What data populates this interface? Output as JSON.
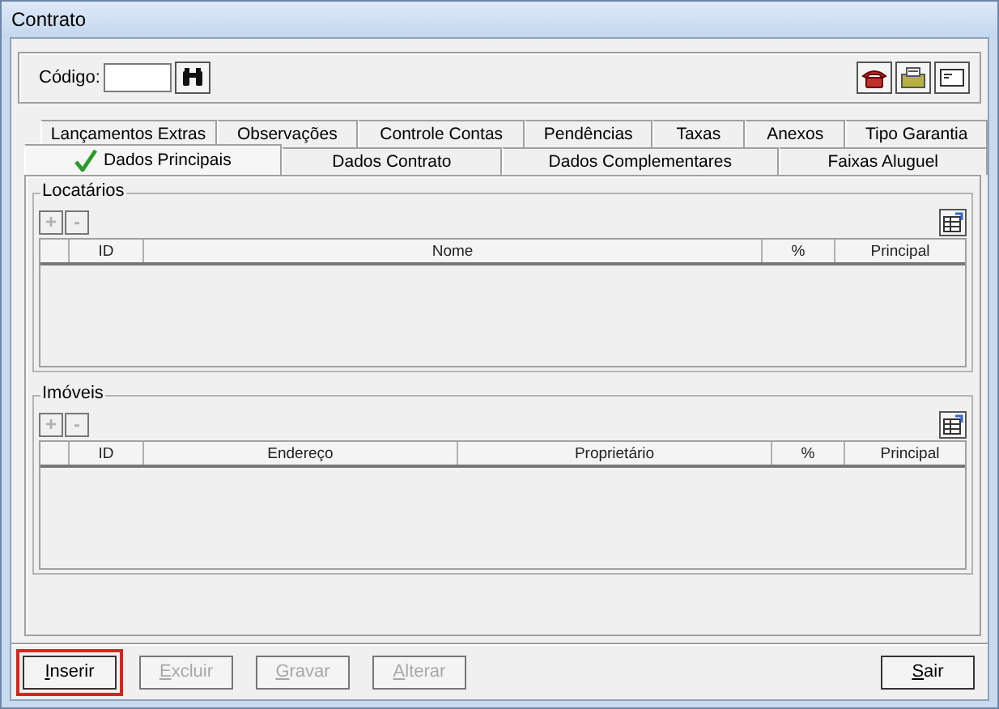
{
  "window": {
    "title": "Contrato"
  },
  "header": {
    "code_label": "Código:"
  },
  "tab_rows": [
    [
      {
        "label": "Lançamentos Extras",
        "selected": false,
        "validated": false
      },
      {
        "label": "Observações",
        "selected": false,
        "validated": false
      },
      {
        "label": "Controle Contas",
        "selected": false,
        "validated": false
      },
      {
        "label": "Pendências",
        "selected": false,
        "validated": false
      },
      {
        "label": "Taxas",
        "selected": false,
        "validated": false
      },
      {
        "label": "Anexos",
        "selected": false,
        "validated": false
      },
      {
        "label": "Tipo Garantia",
        "selected": false,
        "validated": false
      }
    ],
    [
      {
        "label": "Dados Principais",
        "selected": true,
        "validated": true
      },
      {
        "label": "Dados Contrato",
        "selected": false,
        "validated": false
      },
      {
        "label": "Dados Complementares",
        "selected": false,
        "validated": false
      },
      {
        "label": "Faixas Aluguel",
        "selected": false,
        "validated": false
      }
    ]
  ],
  "groups": [
    {
      "title": "Locatários",
      "add": {
        "label": "+",
        "disabled": true
      },
      "remove": {
        "label": "-",
        "disabled": true
      },
      "columns": [
        "",
        "ID",
        "Nome",
        "%",
        "Principal"
      ]
    },
    {
      "title": "Imóveis",
      "add": {
        "label": "+",
        "disabled": true
      },
      "remove": {
        "label": "-",
        "disabled": true
      },
      "columns": [
        "",
        "ID",
        "Endereço",
        "Proprietário",
        "%",
        "Principal"
      ]
    }
  ],
  "buttons": [
    {
      "label": "Inserir",
      "disabled": false,
      "highlighted": true
    },
    {
      "label": "Excluir",
      "disabled": true,
      "highlighted": false
    },
    {
      "label": "Gravar",
      "disabled": true,
      "highlighted": false
    },
    {
      "label": "Alterar",
      "disabled": true,
      "highlighted": false
    },
    {
      "label": "Sair",
      "disabled": false,
      "highlighted": false
    }
  ]
}
